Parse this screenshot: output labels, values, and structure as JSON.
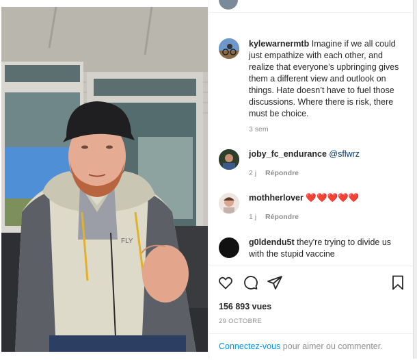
{
  "post": {
    "video": {
      "caption_overlay": ""
    },
    "caption": {
      "username": "kylewarnermtb",
      "text": "Imagine if we all could just empathize with each other, and realize that everyone’s upbringing gives them a different view and outlook on things. Hate doesn’t have to fuel those discussions. Where there is risk, there must be choice.",
      "time": "3 sem"
    },
    "comments": [
      {
        "username": "joby_fc_endurance",
        "text": "@sflwrz",
        "time": "2 j",
        "reply": "Répondre"
      },
      {
        "username": "mothherlover",
        "text": "❤️❤️❤️❤️❤️",
        "time": "1 j",
        "reply": "Répondre"
      },
      {
        "username": "g0ldendu5t",
        "text": "they're trying to divide us with the stupid vaccine",
        "time": "",
        "reply": ""
      }
    ],
    "stats": {
      "views": "156 893 vues",
      "date": "29 OCTOBRE"
    },
    "login": {
      "link": "Connectez-vous",
      "rest": " pour aimer ou commenter."
    }
  },
  "icons": {
    "like": "heart-icon",
    "comment": "comment-bubble-icon",
    "share": "paper-plane-icon",
    "save": "bookmark-icon"
  },
  "colors": {
    "link": "#0095f6",
    "muted": "#8e8e8e",
    "heart": "#ed4956",
    "text": "#262626"
  }
}
